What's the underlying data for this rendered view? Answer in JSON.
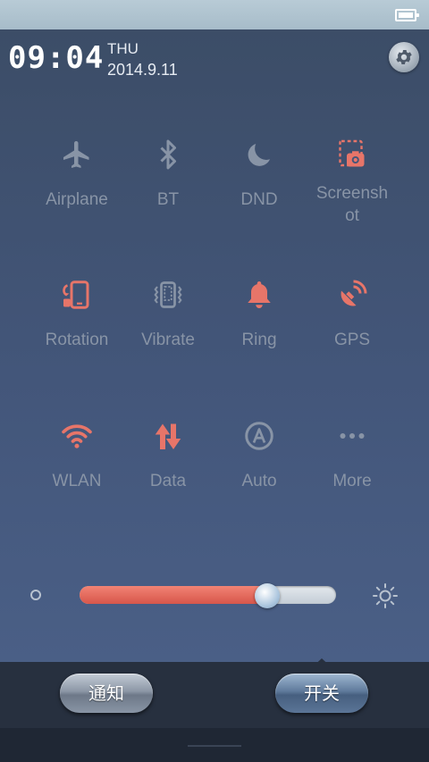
{
  "status": {
    "battery_icon": "battery-full-icon"
  },
  "header": {
    "time": "09:04",
    "day": "THU",
    "date": "2014.9.11",
    "settings_icon": "gear-icon"
  },
  "colors": {
    "active": "#e77569",
    "inactive": "#8894a6"
  },
  "toggles": [
    {
      "label": "Airplane",
      "icon": "airplane-icon",
      "active": false
    },
    {
      "label": "BT",
      "icon": "bluetooth-icon",
      "active": false
    },
    {
      "label": "DND",
      "icon": "moon-icon",
      "active": false
    },
    {
      "label": "Screensh\not",
      "icon": "screenshot-icon",
      "active": false
    },
    {
      "label": "Rotation",
      "icon": "rotation-icon",
      "active": true
    },
    {
      "label": "Vibrate",
      "icon": "vibrate-icon",
      "active": false
    },
    {
      "label": "Ring",
      "icon": "bell-icon",
      "active": true
    },
    {
      "label": "GPS",
      "icon": "gps-icon",
      "active": true
    },
    {
      "label": "WLAN",
      "icon": "wifi-icon",
      "active": true
    },
    {
      "label": "Data",
      "icon": "data-arrows-icon",
      "active": true
    },
    {
      "label": "Auto",
      "icon": "auto-brightness-icon",
      "active": false
    },
    {
      "label": "More",
      "icon": "more-dots-icon",
      "active": false
    }
  ],
  "brightness": {
    "level_percent": 73,
    "low_icon": "brightness-low-icon",
    "high_icon": "brightness-high-icon"
  },
  "bottom_tabs": {
    "notify": "通知",
    "switches": "开关"
  }
}
